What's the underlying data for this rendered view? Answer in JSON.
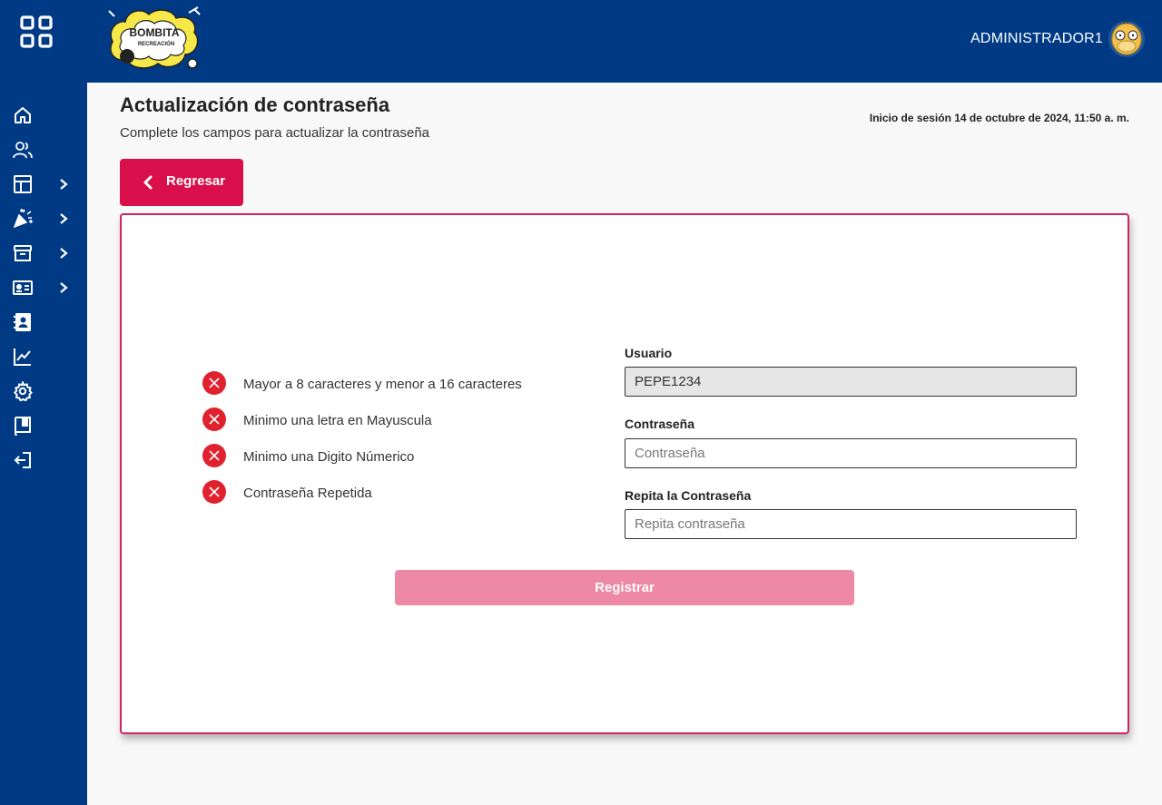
{
  "header": {
    "logo_text_top": "BOMBITA",
    "logo_text_bottom": "RECREACIÓN",
    "user_name": "ADMINISTRADOR1"
  },
  "sidebar": {
    "menu_icon": "grid-icon",
    "items": [
      {
        "icon": "home-icon",
        "has_submenu": false
      },
      {
        "icon": "users-icon",
        "has_submenu": false
      },
      {
        "icon": "layout-icon",
        "has_submenu": true
      },
      {
        "icon": "party-popper-icon",
        "has_submenu": true
      },
      {
        "icon": "archive-icon",
        "has_submenu": true
      },
      {
        "icon": "id-card-icon",
        "has_submenu": true
      },
      {
        "icon": "contacts-book-icon",
        "has_submenu": false
      },
      {
        "icon": "chart-line-icon",
        "has_submenu": false
      },
      {
        "icon": "gear-icon",
        "has_submenu": false
      },
      {
        "icon": "book-icon",
        "has_submenu": false
      },
      {
        "icon": "logout-icon",
        "has_submenu": false
      }
    ]
  },
  "page": {
    "title": "Actualización de contraseña",
    "subtitle": "Complete los campos para actualizar la contraseña",
    "session_info": "Inicio de sesión 14 de octubre de 2024, 11:50 a. m.",
    "back_label": "Regresar"
  },
  "requirements": [
    {
      "text": "Mayor a 8 caracteres y menor a 16 caracteres",
      "status": "invalid"
    },
    {
      "text": "Minimo una letra en Mayuscula",
      "status": "invalid"
    },
    {
      "text": "Minimo una Digito Númerico",
      "status": "invalid"
    },
    {
      "text": "Contraseña Repetida",
      "status": "invalid"
    }
  ],
  "form": {
    "username_label": "Usuario",
    "username_value": "PEPE1234",
    "password_label": "Contraseña",
    "password_placeholder": "Contraseña",
    "repeat_label": "Repita la Contraseña",
    "repeat_placeholder": "Repita contraseña",
    "submit_label": "Registrar"
  },
  "colors": {
    "brand_blue": "#003a85",
    "accent_red": "#d80f4a",
    "error_red": "#e0222e",
    "submit_disabled": "#ee88a7"
  }
}
